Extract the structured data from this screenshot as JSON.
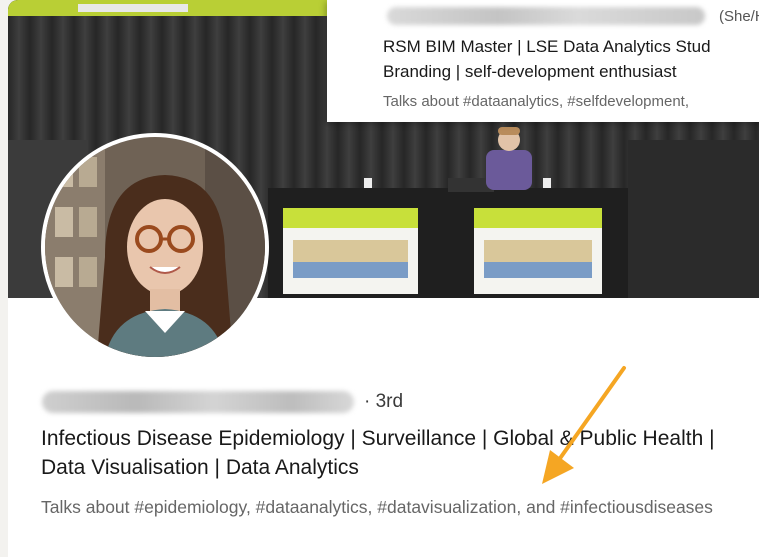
{
  "profile": {
    "connection_degree": "· 3rd",
    "headline": "Infectious Disease Epidemiology | Surveillance | Global & Public Health | Data Visualisation | Data Analytics",
    "talks_about": "Talks about #epidemiology, #dataanalytics, #datavisualization, and #infectiousdiseases"
  },
  "overlay_profile": {
    "pronouns": "(She/H",
    "headline_line1": "RSM BIM Master | LSE Data Analytics Stud",
    "headline_line2": "Branding | self-development enthusiast",
    "talks_about": "Talks about #dataanalytics, #selfdevelopment,"
  },
  "colors": {
    "accent_green": "#c8e03a",
    "annotation_arrow": "#f5a623",
    "secondary_text": "#666666"
  }
}
